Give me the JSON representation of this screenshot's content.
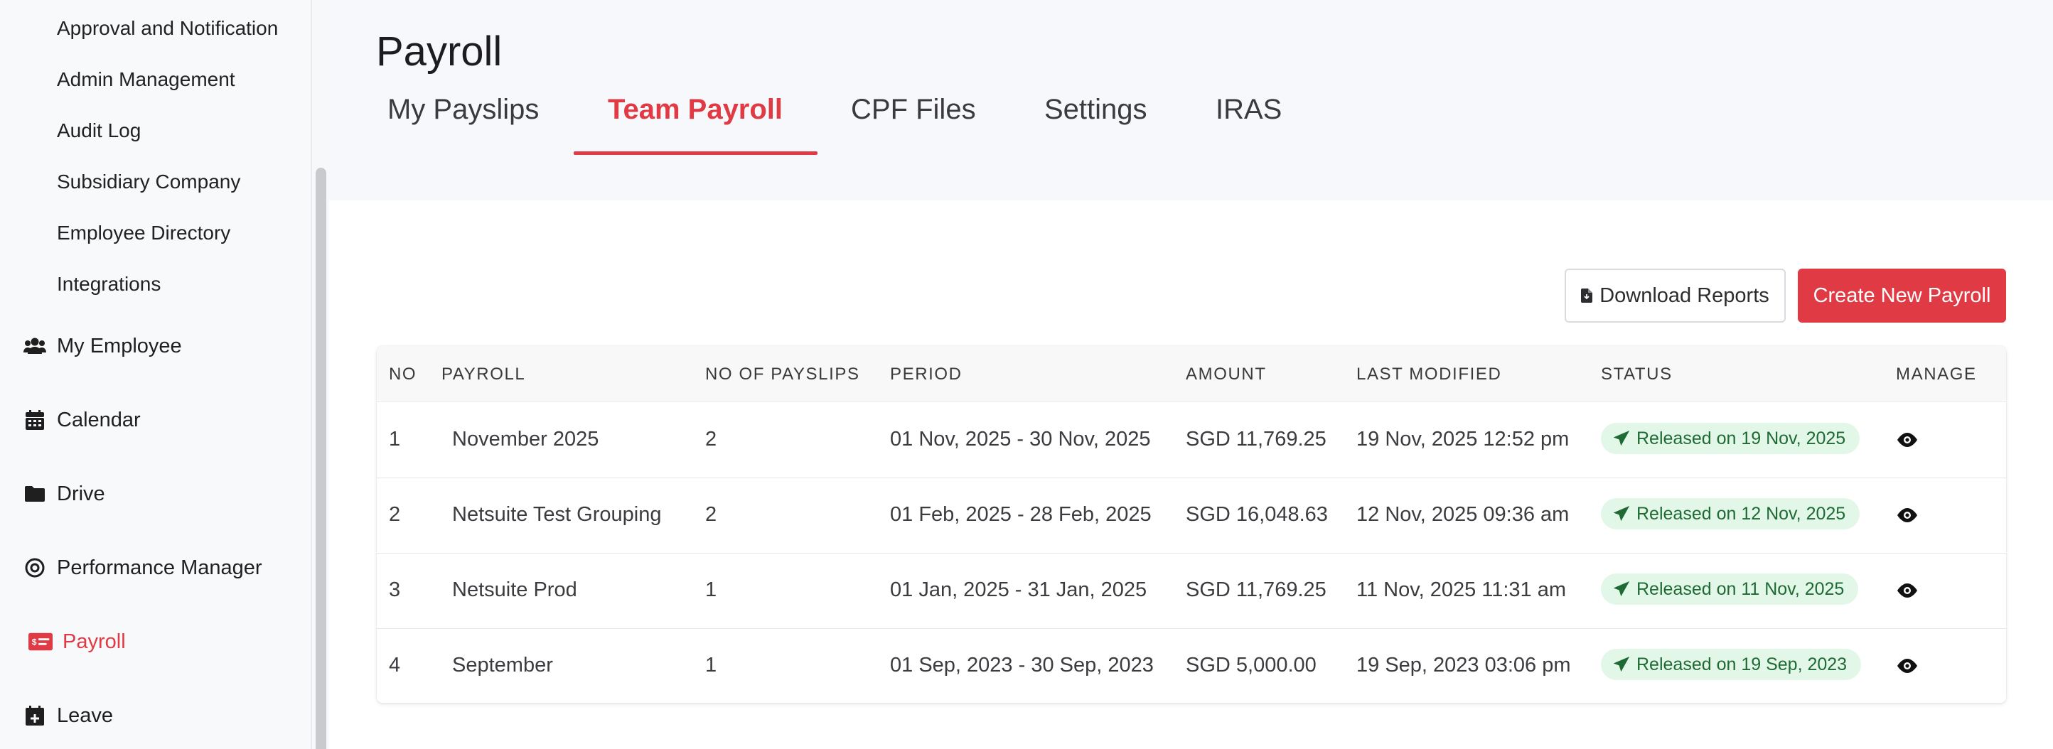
{
  "sidebar": {
    "sub_items": [
      "Approval and Notification",
      "Admin Management",
      "Audit Log",
      "Subsidiary Company",
      "Employee Directory",
      "Integrations"
    ],
    "main_items": [
      {
        "label": "My Employee",
        "icon": "users-icon"
      },
      {
        "label": "Calendar",
        "icon": "calendar-icon"
      },
      {
        "label": "Drive",
        "icon": "folder-icon"
      },
      {
        "label": "Performance Manager",
        "icon": "target-icon"
      },
      {
        "label": "Payroll",
        "icon": "payroll-card-icon",
        "active": true
      },
      {
        "label": "Leave",
        "icon": "calendar-plus-icon"
      }
    ]
  },
  "header": {
    "title": "Payroll",
    "tabs": [
      {
        "label": "My Payslips"
      },
      {
        "label": "Team Payroll",
        "active": true
      },
      {
        "label": "CPF Files"
      },
      {
        "label": "Settings"
      },
      {
        "label": "IRAS"
      }
    ]
  },
  "actions": {
    "download_reports": "Download Reports",
    "create_new_payroll": "Create New Payroll"
  },
  "table": {
    "columns": [
      "NO",
      "PAYROLL",
      "NO OF PAYSLIPS",
      "PERIOD",
      "AMOUNT",
      "LAST MODIFIED",
      "STATUS",
      "MANAGE"
    ],
    "rows": [
      {
        "no": "1",
        "payroll": "November 2025",
        "payslips": "2",
        "period": "01 Nov, 2025 - 30 Nov, 2025",
        "amount": "SGD 11,769.25",
        "last_modified": "19 Nov, 2025 12:52 pm",
        "status": "Released on 19 Nov, 2025"
      },
      {
        "no": "2",
        "payroll": "Netsuite Test Grouping",
        "payslips": "2",
        "period": "01 Feb, 2025 - 28 Feb, 2025",
        "amount": "SGD 16,048.63",
        "last_modified": "12 Nov, 2025 09:36 am",
        "status": "Released on 12 Nov, 2025"
      },
      {
        "no": "3",
        "payroll": "Netsuite Prod",
        "payslips": "1",
        "period": "01 Jan, 2025 - 31 Jan, 2025",
        "amount": "SGD 11,769.25",
        "last_modified": "11 Nov, 2025 11:31 am",
        "status": "Released on 11 Nov, 2025"
      },
      {
        "no": "4",
        "payroll": "September",
        "payslips": "1",
        "period": "01 Sep, 2023 - 30 Sep, 2023",
        "amount": "SGD 5,000.00",
        "last_modified": "19 Sep, 2023 03:06 pm",
        "status": "Released on 19 Sep, 2023"
      }
    ]
  },
  "colors": {
    "accent": "#e03a44",
    "badge_bg": "#e3f7e8",
    "badge_text": "#1f6a34"
  }
}
